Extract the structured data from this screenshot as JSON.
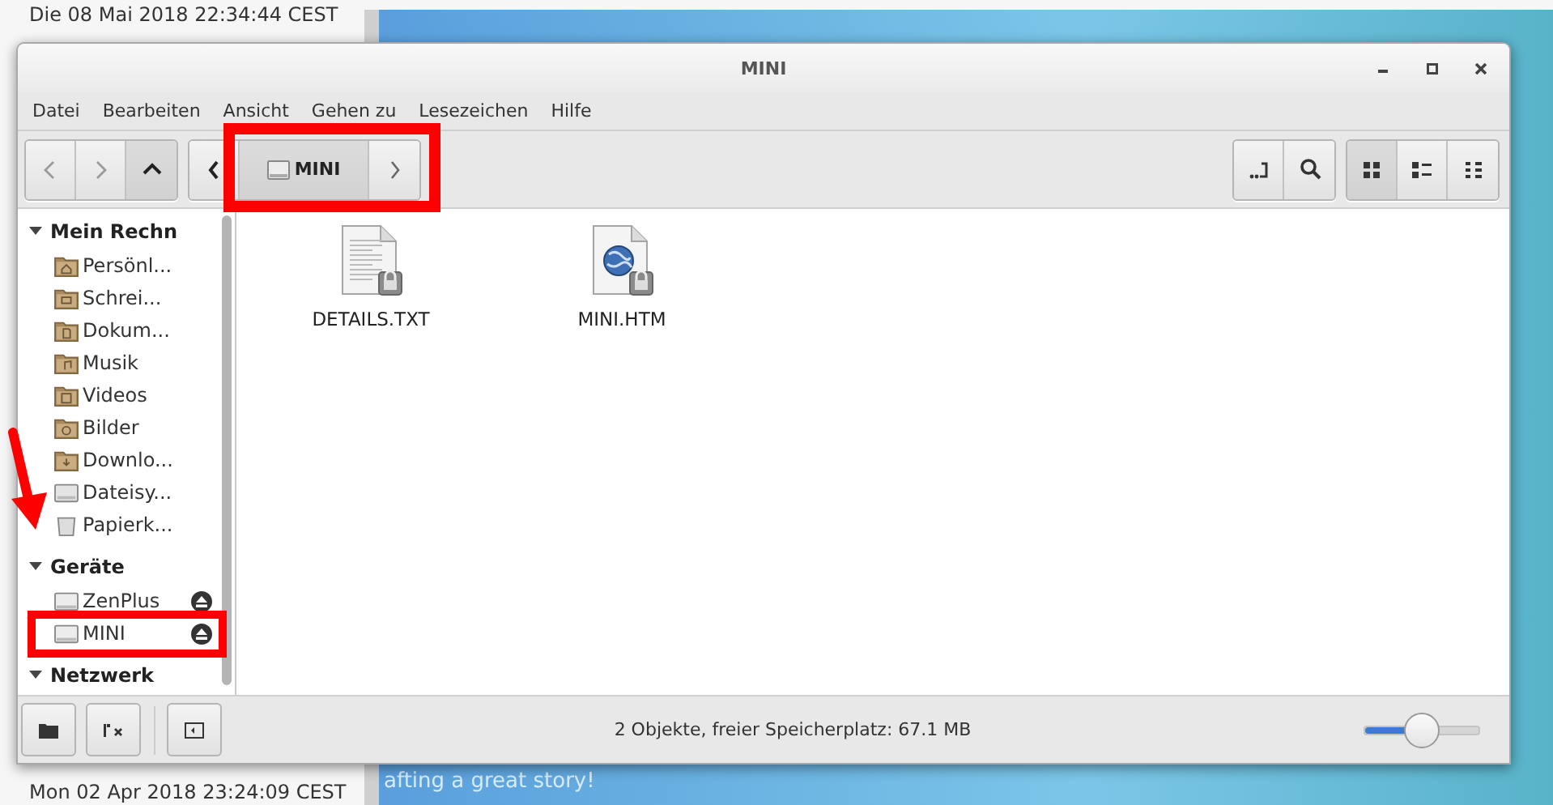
{
  "desktop": {
    "texts": [
      "Die 08 Mai 2018 22:34:44 CEST",
      "Mon 02 Apr 2018 23:24:09 CEST"
    ],
    "wallpaper_text": "afting a great story!"
  },
  "window": {
    "title": "MINI"
  },
  "menu": [
    "Datei",
    "Bearbeiten",
    "Ansicht",
    "Gehen zu",
    "Lesezeichen",
    "Hilfe"
  ],
  "toolbar": {
    "nav_buttons": [
      {
        "kind": "back",
        "disabled": true
      },
      {
        "kind": "forward",
        "disabled": true
      },
      {
        "kind": "up",
        "disabled": false
      }
    ],
    "breadcrumb": [
      {
        "label": "MINI",
        "selected": true
      }
    ],
    "tool_buttons": [
      {
        "kind": "location"
      },
      {
        "kind": "search"
      }
    ],
    "view_buttons": [
      {
        "kind": "icons",
        "selected": true
      },
      {
        "kind": "compact",
        "selected": false
      },
      {
        "kind": "details",
        "selected": false
      }
    ]
  },
  "sidebar": {
    "sections": [
      {
        "title": "Mein Rechn",
        "expanded": true,
        "items": [
          {
            "label": "Persönl...",
            "kind": "home"
          },
          {
            "label": "Schrei...",
            "kind": "desktop"
          },
          {
            "label": "Dokum...",
            "kind": "documents"
          },
          {
            "label": "Musik",
            "kind": "music"
          },
          {
            "label": "Videos",
            "kind": "videos"
          },
          {
            "label": "Bilder",
            "kind": "pictures"
          },
          {
            "label": "Downlo...",
            "kind": "downloads"
          },
          {
            "label": "Dateisy...",
            "kind": "filesystem"
          },
          {
            "label": "Papierk...",
            "kind": "trash"
          }
        ]
      },
      {
        "title": "Geräte",
        "expanded": true,
        "items": [
          {
            "label": "ZenPlus",
            "kind": "drive",
            "ejectable": true
          },
          {
            "label": "MINI",
            "kind": "drive",
            "ejectable": true
          }
        ]
      },
      {
        "title": "Netzwerk",
        "expanded": true
      }
    ]
  },
  "files": [
    {
      "name": "DETAILS.TXT",
      "kind": "text",
      "locked": true
    },
    {
      "name": "MINI.HTM",
      "kind": "html",
      "locked": true
    }
  ],
  "status_bar": {
    "buttons": [
      {
        "kind": "places"
      },
      {
        "kind": "tree"
      },
      {
        "kind": "hide-sidebar"
      }
    ],
    "text": "2 Objekte, freier Speicherplatz: 67.1 MB",
    "zoom": {
      "level": 0.5
    }
  },
  "annotations": [
    {
      "kind": "frame"
    },
    {
      "kind": "frame"
    },
    {
      "kind": "arrow"
    }
  ]
}
